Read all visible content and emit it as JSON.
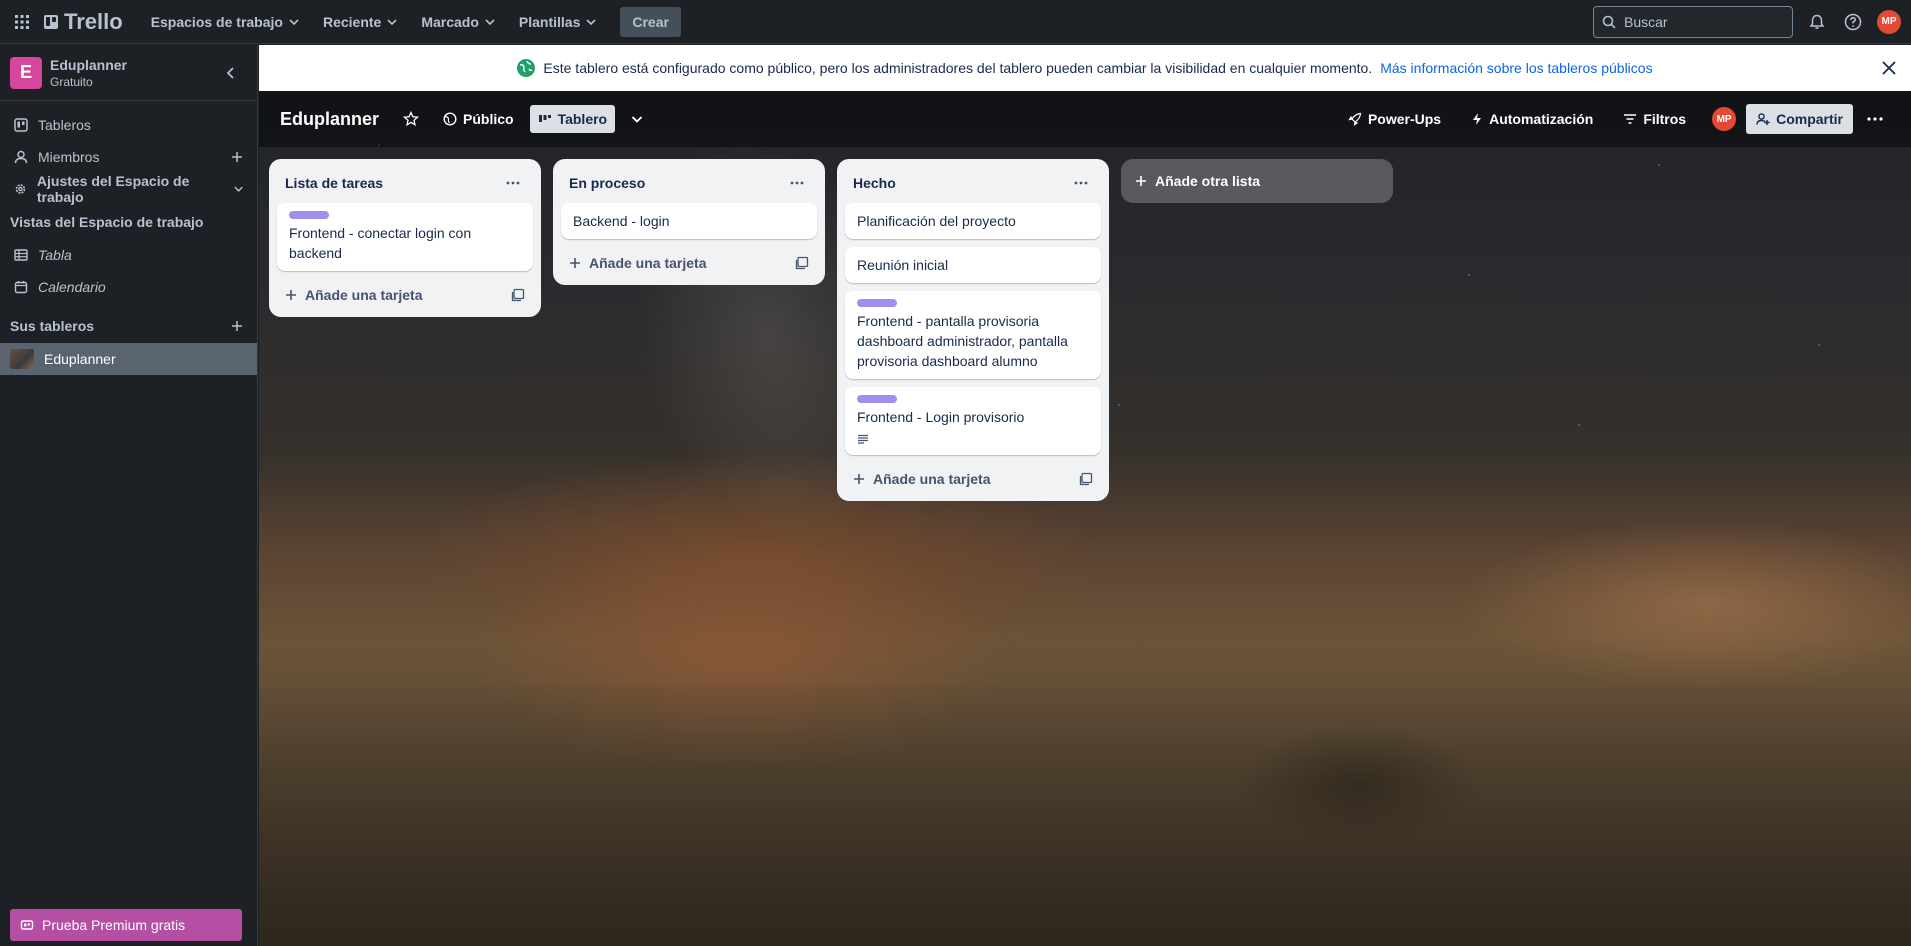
{
  "topnav": {
    "logo": "Trello",
    "menu": [
      "Espacios de trabajo",
      "Reciente",
      "Marcado",
      "Plantillas"
    ],
    "create": "Crear",
    "search_placeholder": "Buscar",
    "avatar": "MP"
  },
  "sidebar": {
    "workspace_initial": "E",
    "workspace_name": "Eduplanner",
    "workspace_plan": "Gratuito",
    "items": [
      "Tableros",
      "Miembros",
      "Ajustes del Espacio de trabajo"
    ],
    "views_heading": "Vistas del Espacio de trabajo",
    "views": [
      "Tabla",
      "Calendario"
    ],
    "boards_heading": "Sus tableros",
    "boards": [
      "Eduplanner"
    ],
    "premium": "Prueba Premium gratis"
  },
  "banner": {
    "message": "Este tablero está configurado como público, pero los administradores del tablero pueden cambiar la visibilidad en cualquier momento.",
    "link": "Más información sobre los tableros públicos"
  },
  "board": {
    "title": "Eduplanner",
    "visibility": "Público",
    "view": "Tablero",
    "powerups": "Power-Ups",
    "automation": "Automatización",
    "filters": "Filtros",
    "avatar": "MP",
    "share": "Compartir"
  },
  "lists": [
    {
      "title": "Lista de tareas",
      "cards": [
        {
          "text": "Frontend - conectar login con backend",
          "label": true,
          "desc": false
        }
      ],
      "add": "Añade una tarjeta"
    },
    {
      "title": "En proceso",
      "cards": [
        {
          "text": "Backend - login",
          "label": false,
          "desc": false
        }
      ],
      "add": "Añade una tarjeta"
    },
    {
      "title": "Hecho",
      "cards": [
        {
          "text": "Planificación del proyecto",
          "label": false,
          "desc": false
        },
        {
          "text": "Reunión inicial",
          "label": false,
          "desc": false
        },
        {
          "text": "Frontend - pantalla provisoria dashboard administrador, pantalla provisoria dashboard alumno",
          "label": true,
          "desc": false
        },
        {
          "text": "Frontend - Login provisorio",
          "label": true,
          "desc": true
        }
      ],
      "add": "Añade una tarjeta"
    }
  ],
  "add_list": "Añade otra lista",
  "colors": {
    "label_purple": "#9f8fef",
    "workspace_badge": "#d6469a",
    "avatar": "#e34935",
    "premium": "#b44fa3"
  }
}
